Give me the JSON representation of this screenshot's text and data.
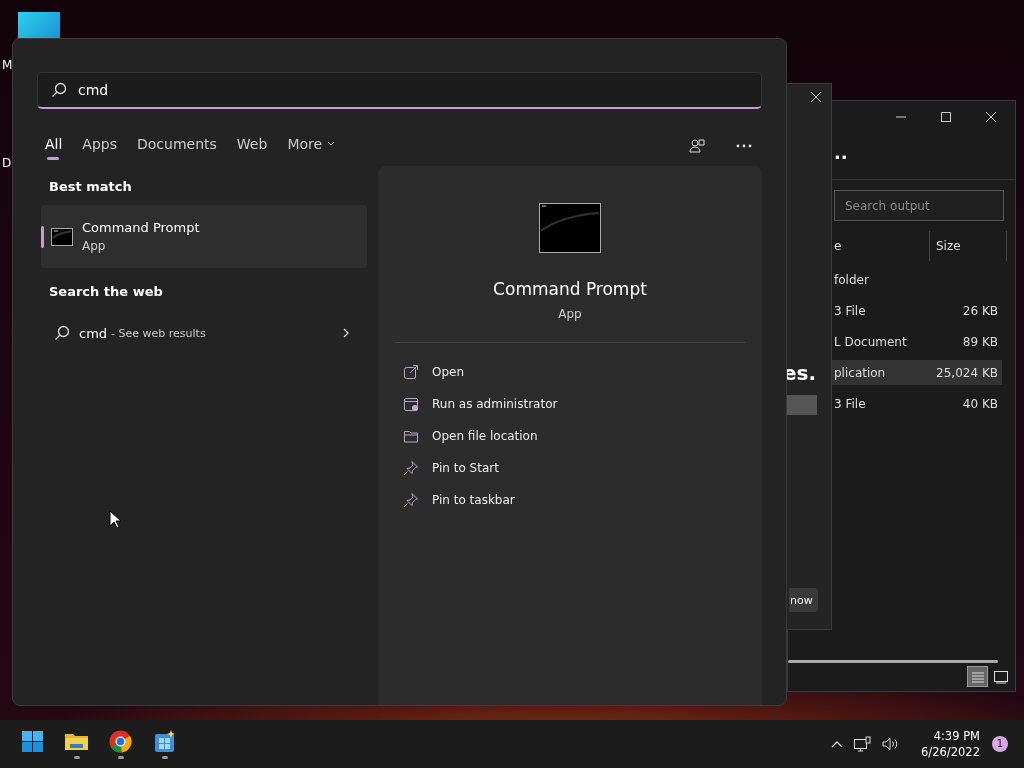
{
  "desktop": {
    "icons": [
      {
        "label": "M"
      },
      {
        "label": "D"
      }
    ]
  },
  "dialog": {
    "heading": "es.",
    "button": "now"
  },
  "explorer": {
    "title": "..",
    "search": {
      "placeholder": "Search output"
    },
    "columns": [
      "e",
      "Size"
    ],
    "rows": [
      {
        "name": "folder",
        "size": "",
        "selected": false
      },
      {
        "name": "3 File",
        "size": "26 KB",
        "selected": false
      },
      {
        "name": "L Document",
        "size": "89 KB",
        "selected": false
      },
      {
        "name": "plication",
        "size": "25,024 KB",
        "selected": true
      },
      {
        "name": "3 File",
        "size": "40 KB",
        "selected": false
      }
    ],
    "views": [
      {
        "kind": "details",
        "selected": true
      },
      {
        "kind": "preview",
        "selected": false
      }
    ]
  },
  "start_menu": {
    "search": {
      "value": "cmd"
    },
    "tabs": [
      {
        "label": "All",
        "selected": true,
        "kind": "tab"
      },
      {
        "label": "Apps",
        "selected": false,
        "kind": "tab"
      },
      {
        "label": "Documents",
        "selected": false,
        "kind": "tab"
      },
      {
        "label": "Web",
        "selected": false,
        "kind": "tab"
      },
      {
        "label": "More",
        "selected": false,
        "kind": "dropdown"
      }
    ],
    "best_match": {
      "heading": "Best match",
      "title": "Command Prompt",
      "subtitle": "App",
      "selected": true
    },
    "web": {
      "heading": "Search the web",
      "query": "cmd",
      "suffix": "- See web results"
    },
    "preview": {
      "title": "Command Prompt",
      "subtitle": "App",
      "actions": [
        {
          "label": "Open",
          "kind": "open"
        },
        {
          "label": "Run as administrator",
          "kind": "admin"
        },
        {
          "label": "Open file location",
          "kind": "folder"
        },
        {
          "label": "Pin to Start",
          "kind": "pin"
        },
        {
          "label": "Pin to taskbar",
          "kind": "pin"
        }
      ]
    }
  },
  "taskbar": {
    "apps": [
      {
        "kind": "start",
        "running": false
      },
      {
        "kind": "files",
        "running": true
      },
      {
        "kind": "browser",
        "running": true
      },
      {
        "kind": "store",
        "running": true
      }
    ],
    "time": "4:39 PM",
    "date": "6/26/2022",
    "notifications": "1"
  }
}
